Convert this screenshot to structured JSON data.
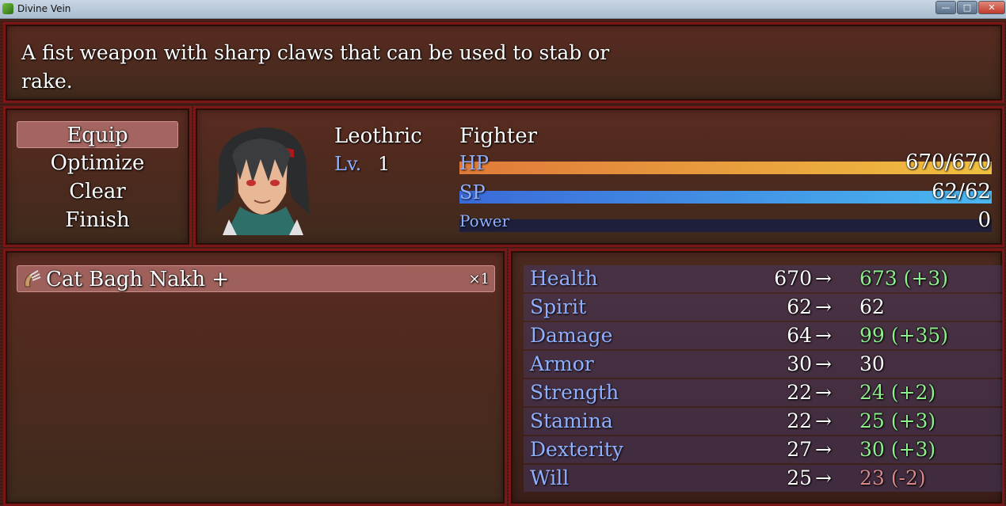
{
  "window": {
    "title": "Divine Vein",
    "min_glyph": "—",
    "max_glyph": "□",
    "close_glyph": "✕"
  },
  "help": {
    "text": "A fist weapon with sharp claws that can be used to stab or rake."
  },
  "commands": [
    {
      "label": "Equip",
      "selected": true
    },
    {
      "label": "Optimize",
      "selected": false
    },
    {
      "label": "Clear",
      "selected": false
    },
    {
      "label": "Finish",
      "selected": false
    }
  ],
  "actor": {
    "name": "Leothric",
    "level_label": "Lv.",
    "level": "1",
    "class": "Fighter",
    "portrait_icon": "portrait-face-icon",
    "gauges": {
      "hp": {
        "label": "HP",
        "value": "670/670",
        "fraction": 1.0,
        "color_start": "#e07a3a",
        "color_end": "#f0c040"
      },
      "sp": {
        "label": "SP",
        "value": "62/62",
        "fraction": 1.0,
        "color_start": "#3a6ad8",
        "color_end": "#4ab8f0"
      },
      "power": {
        "label": "Power",
        "value": "0",
        "fraction": 0.0,
        "color_start": "#3a3a8a",
        "color_end": "#5a5aca"
      }
    }
  },
  "items": [
    {
      "icon": "claw-icon",
      "name": "Cat Bagh Nakh +",
      "count": "×1"
    }
  ],
  "stats": [
    {
      "name": "Health",
      "old": "670",
      "arrow": "→",
      "new": "673 (+3)",
      "trend": "up"
    },
    {
      "name": "Spirit",
      "old": "62",
      "arrow": "→",
      "new": "62",
      "trend": "same"
    },
    {
      "name": "Damage",
      "old": "64",
      "arrow": "→",
      "new": "99 (+35)",
      "trend": "up"
    },
    {
      "name": "Armor",
      "old": "30",
      "arrow": "→",
      "new": "30",
      "trend": "same"
    },
    {
      "name": "Strength",
      "old": "22",
      "arrow": "→",
      "new": "24 (+2)",
      "trend": "up"
    },
    {
      "name": "Stamina",
      "old": "22",
      "arrow": "→",
      "new": "25 (+3)",
      "trend": "up"
    },
    {
      "name": "Dexterity",
      "old": "27",
      "arrow": "→",
      "new": "30 (+3)",
      "trend": "up"
    },
    {
      "name": "Will",
      "old": "25",
      "arrow": "→",
      "new": "23 (-2)",
      "trend": "down"
    }
  ]
}
